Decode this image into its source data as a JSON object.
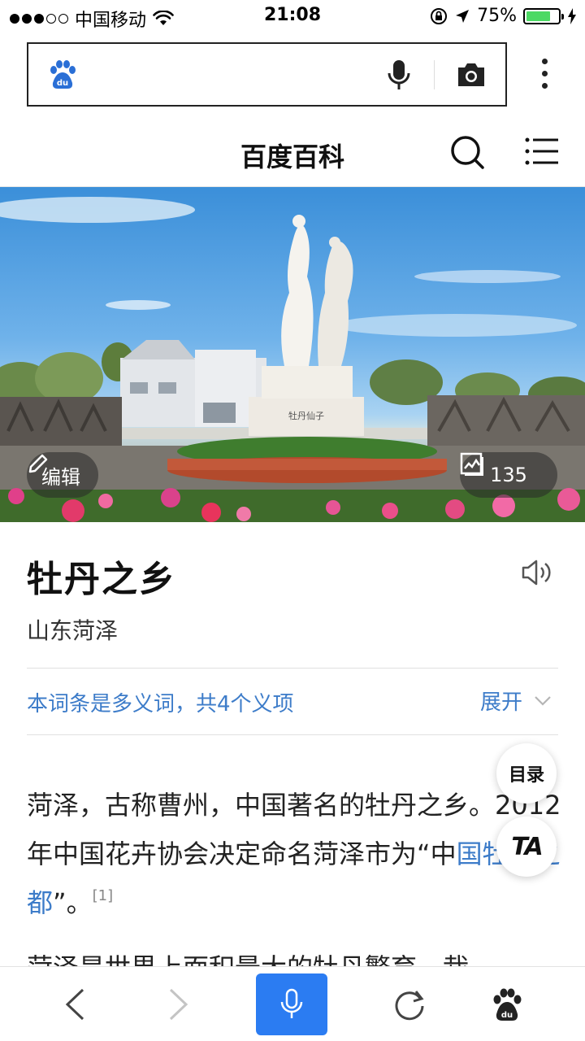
{
  "status_bar": {
    "carrier": "中国移动",
    "time": "21:08",
    "battery_percent": "75%",
    "battery_level": 0.75,
    "signal_bars_filled": 3,
    "signal_bars_total": 5
  },
  "search": {
    "logo_text": "du",
    "icons": [
      "baidu-paw-icon",
      "microphone-icon",
      "camera-icon",
      "more-vertical-icon"
    ]
  },
  "header": {
    "title": "百度百科",
    "icons": [
      "search-icon",
      "menu-icon"
    ]
  },
  "hero": {
    "edit_label": "编辑",
    "photo_count": "135",
    "plaque_text": "牡丹仙子"
  },
  "entry": {
    "title": "牡丹之乡",
    "subtitle": "山东菏泽",
    "polysemy_note": "本词条是多义词，共4个义项",
    "expand_label": "展开",
    "paragraph_part1": "菏泽，古称曹州，中国著名的牡丹之乡。2012年中国花卉协会决定命名菏泽市为“中",
    "paragraph_link": "国牡丹之都",
    "paragraph_part2": "”。",
    "citation": "[1]",
    "next_line": "菏泽是世界上面积最大的牡丹繁育、栽"
  },
  "floating": {
    "toc_label": "目录",
    "ta_label": "TA"
  },
  "colors": {
    "link_blue": "#3d7cc9",
    "voice_button_blue": "#2b7cf2",
    "baidu_logo_blue": "#2a6fd6",
    "battery_green": "#4cd964"
  }
}
